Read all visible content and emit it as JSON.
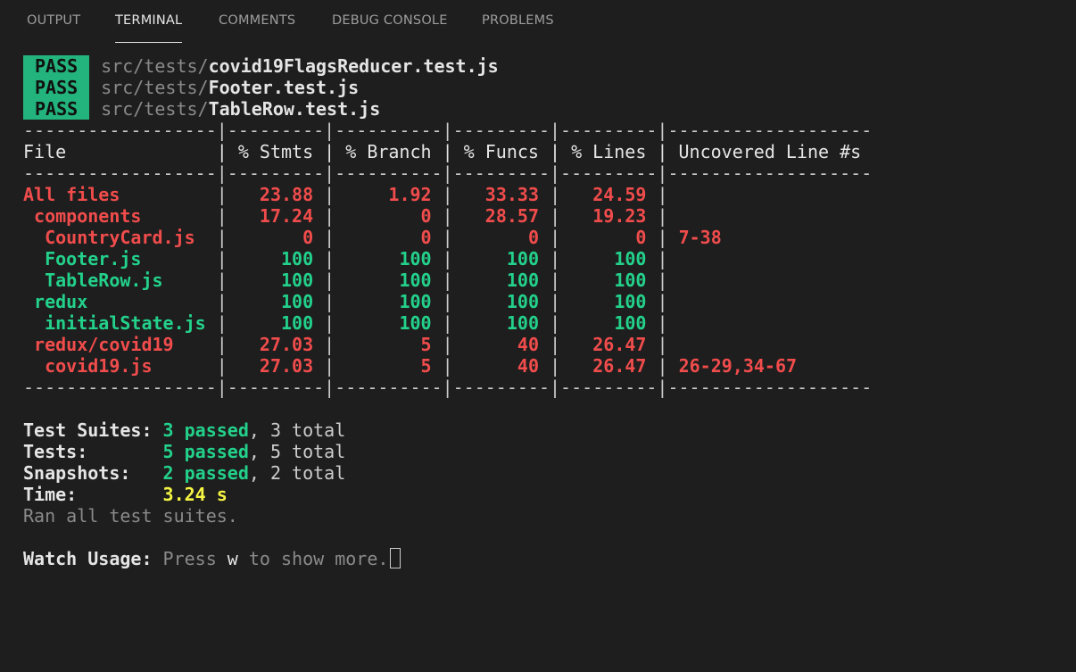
{
  "panel": {
    "tabs": [
      {
        "label": "OUTPUT",
        "active": false
      },
      {
        "label": "TERMINAL",
        "active": true
      },
      {
        "label": "COMMENTS",
        "active": false
      },
      {
        "label": "DEBUG CONSOLE",
        "active": false
      },
      {
        "label": "PROBLEMS",
        "active": false
      }
    ]
  },
  "terminal": {
    "test_results": [
      {
        "status": "PASS",
        "dir": "src/tests/",
        "file": "covid19FlagsReducer.test.js"
      },
      {
        "status": "PASS",
        "dir": "src/tests/",
        "file": "Footer.test.js"
      },
      {
        "status": "PASS",
        "dir": "src/tests/",
        "file": "TableRow.test.js"
      }
    ],
    "coverage": {
      "separator": "------------------|---------|----------|---------|---------|-------------------",
      "header": "File              | % Stmts | % Branch | % Funcs | % Lines | Uncovered Line #s ",
      "rows": [
        {
          "name": "All files",
          "stmts": "23.88",
          "branch": "1.92",
          "funcs": "33.33",
          "lines": "24.59",
          "uncovered": "",
          "status": "low",
          "indent": 0
        },
        {
          "name": "components",
          "stmts": "17.24",
          "branch": "0",
          "funcs": "28.57",
          "lines": "19.23",
          "uncovered": "",
          "status": "low",
          "indent": 1
        },
        {
          "name": "CountryCard.js",
          "stmts": "0",
          "branch": "0",
          "funcs": "0",
          "lines": "0",
          "uncovered": "7-38",
          "status": "low",
          "indent": 2
        },
        {
          "name": "Footer.js",
          "stmts": "100",
          "branch": "100",
          "funcs": "100",
          "lines": "100",
          "uncovered": "",
          "status": "high",
          "indent": 2
        },
        {
          "name": "TableRow.js",
          "stmts": "100",
          "branch": "100",
          "funcs": "100",
          "lines": "100",
          "uncovered": "",
          "status": "high",
          "indent": 2
        },
        {
          "name": "redux",
          "stmts": "100",
          "branch": "100",
          "funcs": "100",
          "lines": "100",
          "uncovered": "",
          "status": "high",
          "indent": 1
        },
        {
          "name": "initialState.js",
          "stmts": "100",
          "branch": "100",
          "funcs": "100",
          "lines": "100",
          "uncovered": "",
          "status": "high",
          "indent": 2
        },
        {
          "name": "redux/covid19",
          "stmts": "27.03",
          "branch": "5",
          "funcs": "40",
          "lines": "26.47",
          "uncovered": "",
          "status": "low",
          "indent": 1
        },
        {
          "name": "covid19.js",
          "stmts": "27.03",
          "branch": "5",
          "funcs": "40",
          "lines": "26.47",
          "uncovered": "26-29,34-67",
          "status": "low",
          "indent": 2
        }
      ]
    },
    "summary": {
      "suites": {
        "label": "Test Suites: ",
        "passed": "3 passed",
        "total": ", 3 total"
      },
      "tests": {
        "label": "Tests:       ",
        "passed": "5 passed",
        "total": ", 5 total"
      },
      "snapshots": {
        "label": "Snapshots:   ",
        "passed": "2 passed",
        "total": ", 2 total"
      },
      "time": {
        "label": "Time:        ",
        "value": "3.24 s"
      },
      "ran_text": "Ran all test suites."
    },
    "watch": {
      "label": "Watch Usage: ",
      "press": "Press ",
      "key": "w",
      "rest": " to show more."
    }
  },
  "colors": {
    "background": "#1e1e1e",
    "pass_badge": "#23b37c",
    "red": "#f14c4c",
    "green": "#23d18b",
    "yellow": "#f5f543"
  }
}
